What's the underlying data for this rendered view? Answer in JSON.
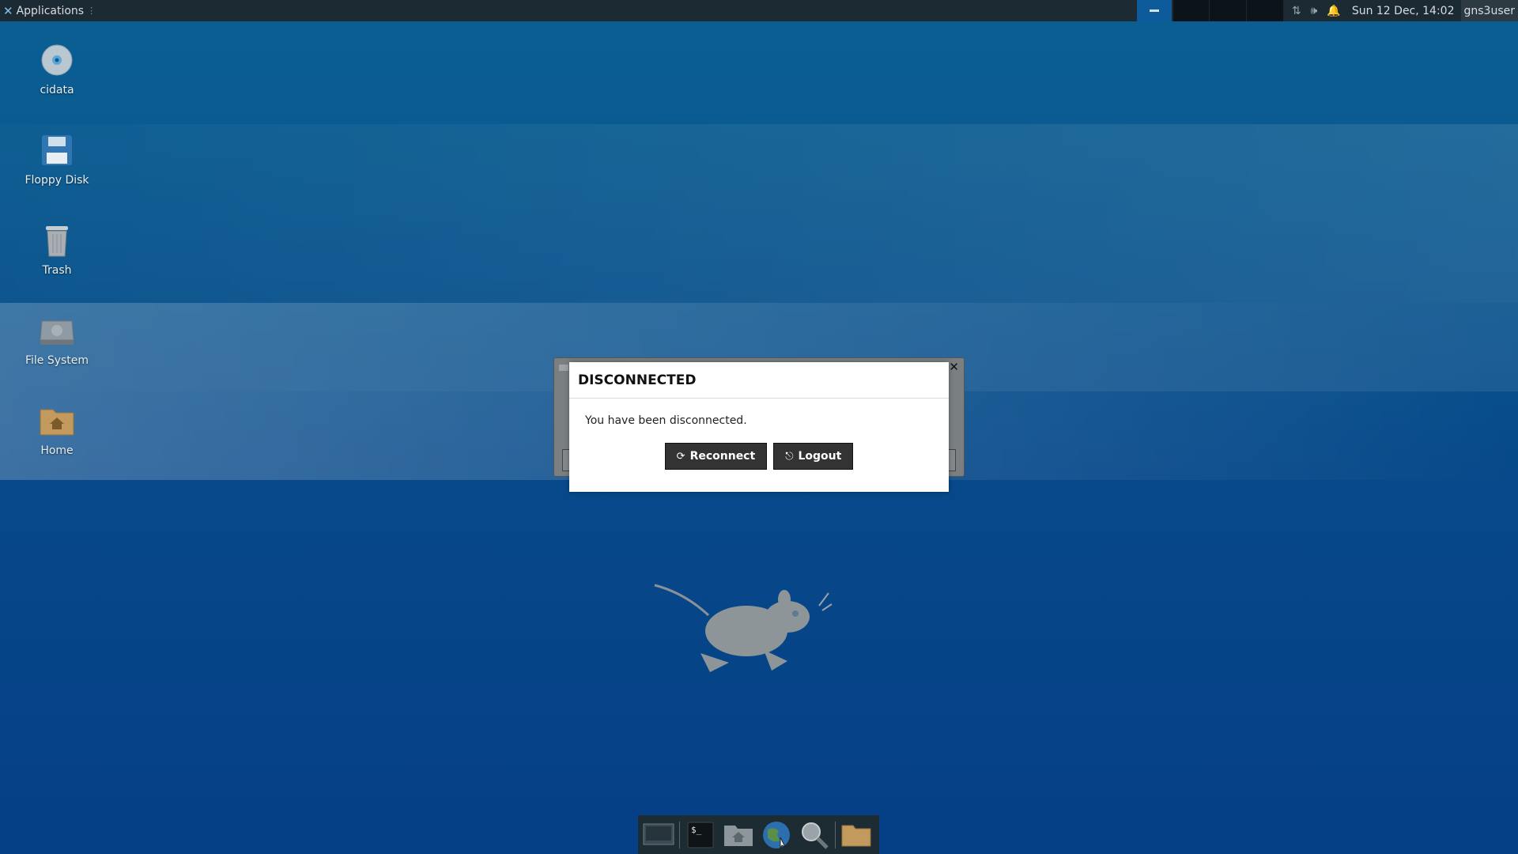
{
  "top_panel": {
    "applications_label": "Applications",
    "clock": "Sun 12 Dec, 14:02",
    "user": "gns3user"
  },
  "desktop_icons": [
    {
      "label": "cidata",
      "icon": "cd-icon"
    },
    {
      "label": "Floppy Disk",
      "icon": "floppy-icon"
    },
    {
      "label": "Trash",
      "icon": "trash-icon"
    },
    {
      "label": "File System",
      "icon": "harddisk-icon"
    },
    {
      "label": "Home",
      "icon": "home-folder-icon"
    }
  ],
  "dialog": {
    "title": "DISCONNECTED",
    "message": "You have been disconnected.",
    "reconnect_label": "Reconnect",
    "logout_label": "Logout"
  },
  "dock": {
    "items": [
      "show-desktop-icon",
      "terminal-icon",
      "file-manager-icon",
      "web-browser-icon",
      "app-finder-icon",
      "folder-icon"
    ]
  },
  "colors": {
    "panel_bg": "#1b2a33",
    "desktop_top": "#0a5f93",
    "desktop_bottom": "#053f86",
    "button_bg": "#333333"
  }
}
